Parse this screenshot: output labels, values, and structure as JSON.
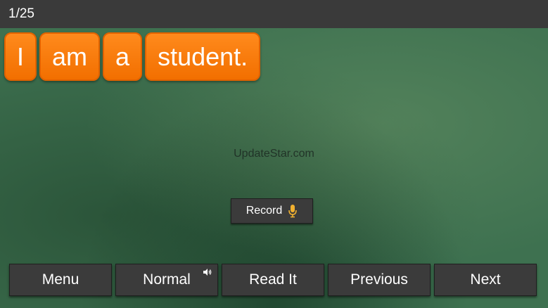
{
  "header": {
    "counter": "1/25"
  },
  "sentence": {
    "words": [
      "I",
      "am",
      "a",
      "student."
    ]
  },
  "watermark": "UpdateStar.com",
  "record": {
    "label": "Record",
    "icon": "microphone-icon"
  },
  "bottom_bar": {
    "menu_label": "Menu",
    "mode_label": "Normal",
    "mode_icon": "speaker-icon",
    "read_label": "Read It",
    "previous_label": "Previous",
    "next_label": "Next"
  },
  "colors": {
    "tile": "#f57a0a",
    "board": "#3e7150",
    "button": "#3b3b3b",
    "topbar": "#3a3a3a",
    "mic": "#f0b030"
  }
}
